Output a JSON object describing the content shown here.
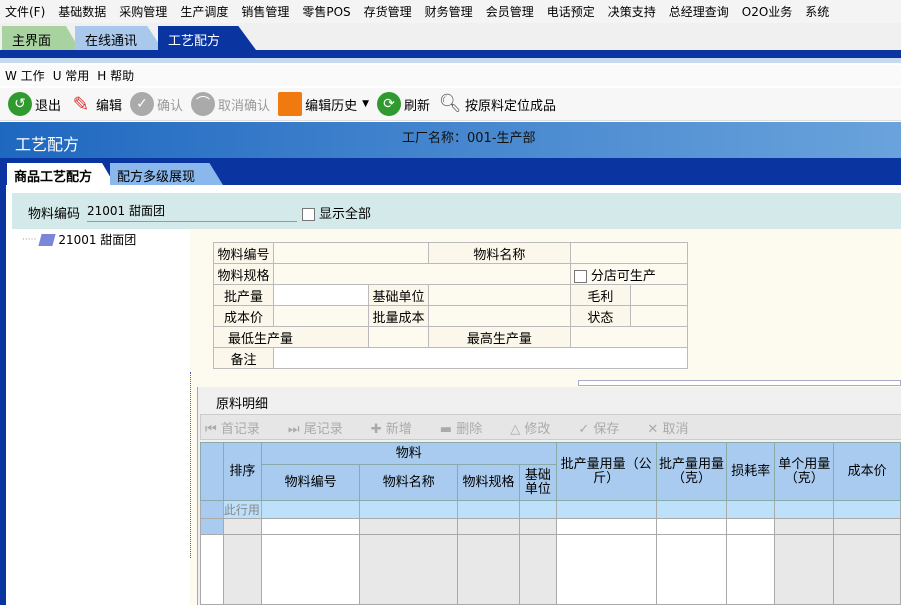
{
  "menubar": [
    "文件(F)",
    "基础数据",
    "采购管理",
    "生产调度",
    "销售管理",
    "零售POS",
    "存货管理",
    "财务管理",
    "会员管理",
    "电话预定",
    "决策支持",
    "总经理查询",
    "O2O业务",
    "系统"
  ],
  "main_tabs": [
    "主界面",
    "在线通讯",
    "工艺配方"
  ],
  "menu2": [
    "W 工作",
    "U 常用",
    "H 帮助"
  ],
  "toolbar": {
    "exit": "退出",
    "edit": "编辑",
    "confirm": "确认",
    "cancel_confirm": "取消确认",
    "history": "编辑历史",
    "refresh": "刷新",
    "locate": "按原料定位成品"
  },
  "header": {
    "title": "工艺配方",
    "factory": "工厂名称：001-生产部"
  },
  "sub_tabs": [
    "商品工艺配方",
    "配方多级展现"
  ],
  "filter": {
    "label": "物料编码",
    "value": "21001 甜面团",
    "show_all": "显示全部"
  },
  "tree": {
    "node": "21001 甜面团"
  },
  "form": {
    "code": "物料编号",
    "name": "物料名称",
    "spec": "物料规格",
    "branch": "分店可生产",
    "batch": "批产量",
    "unit": "基础单位",
    "profit": "毛利",
    "cost": "成本价",
    "batch_cost": "批量成本",
    "status": "状态",
    "min": "最低生产量",
    "max": "最高生产量",
    "remark": "备注"
  },
  "grid": {
    "title": "原料明细",
    "tools": [
      "首记录",
      "尾记录",
      "新增",
      "删除",
      "修改",
      "保存",
      "取消"
    ],
    "headers": {
      "sort": "排序",
      "material": "物料",
      "code": "物料编号",
      "name": "物料名称",
      "spec": "物料规格",
      "unit": "基础单位",
      "kg": "批产量用量（公斤）",
      "g": "批产量用量（克）",
      "loss": "损耗率",
      "single": "单个用量（克）",
      "cost": "成本价"
    },
    "filter_row": "此行用"
  }
}
